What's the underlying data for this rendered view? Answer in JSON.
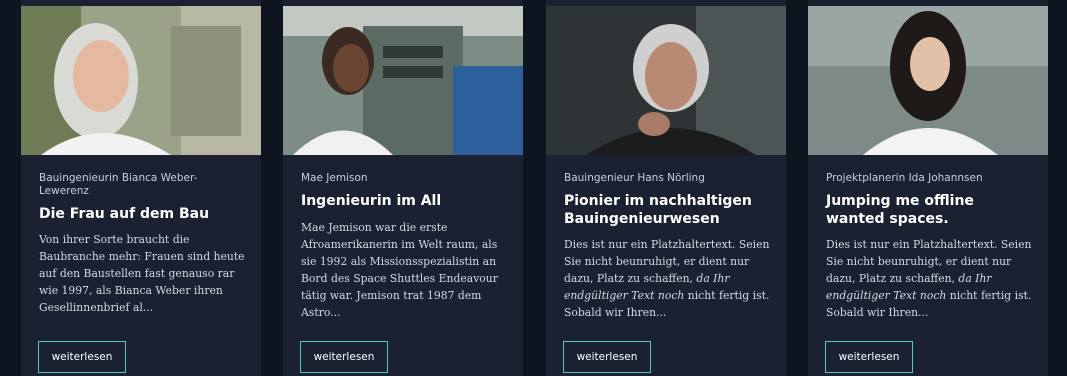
{
  "cards": [
    {
      "meta": "Bauingenieurin Bianca Weber-Lewerenz",
      "title": "Die Frau auf dem Bau",
      "excerpt": "Von ihrer Sorte braucht die Baubranche mehr: Frauen sind heute auf den Baustellen fast genauso rar wie 1997, als Bianca Weber ihren Gesellinnenbrief al...",
      "button": "weiterlesen",
      "image": "portrait-woman-gray-hair"
    },
    {
      "meta": "Mae Jemison",
      "title": "Ingenieurin im All",
      "excerpt": "Mae Jemison war die erste Afroamerikanerin im Welt raum, als sie 1992 als Missionsspezialistin an Bord des Space Shuttles Endeavour tätig war. Jemison trat 1987 dem Astro...",
      "button": "weiterlesen",
      "image": "portrait-astronaut-control-panel"
    },
    {
      "meta": "Bauingenieur Hans Nörling",
      "title": "Pionier im nachhaltigen Bauingenieurwesen",
      "excerpt_a": "Dies ist nur ein Platzhaltertext. Seien Sie nicht beunruhigt, er dient nur dazu, Platz zu schaffen,",
      "excerpt_b": "da Ihr endgültiger Text noch",
      "excerpt_c": "nicht fertig ist. Sobald wir Ihren...",
      "button": "weiterlesen",
      "image": "portrait-older-man"
    },
    {
      "meta": "Projektplanerin Ida Johannsen",
      "title": "Jumping me offline wanted spaces.",
      "excerpt_a": "Dies ist nur ein Platzhaltertext. Seien Sie nicht beunruhigt, er dient nur dazu, Platz zu schaffen,",
      "excerpt_b": "da Ihr endgültiger Text noch",
      "excerpt_c": "nicht fertig ist. Sobald wir Ihren...",
      "button": "weiterlesen",
      "image": "portrait-young-woman"
    }
  ],
  "colors": {
    "background": "#0f1520",
    "card": "#1b2130",
    "accent": "#52c7c3"
  }
}
